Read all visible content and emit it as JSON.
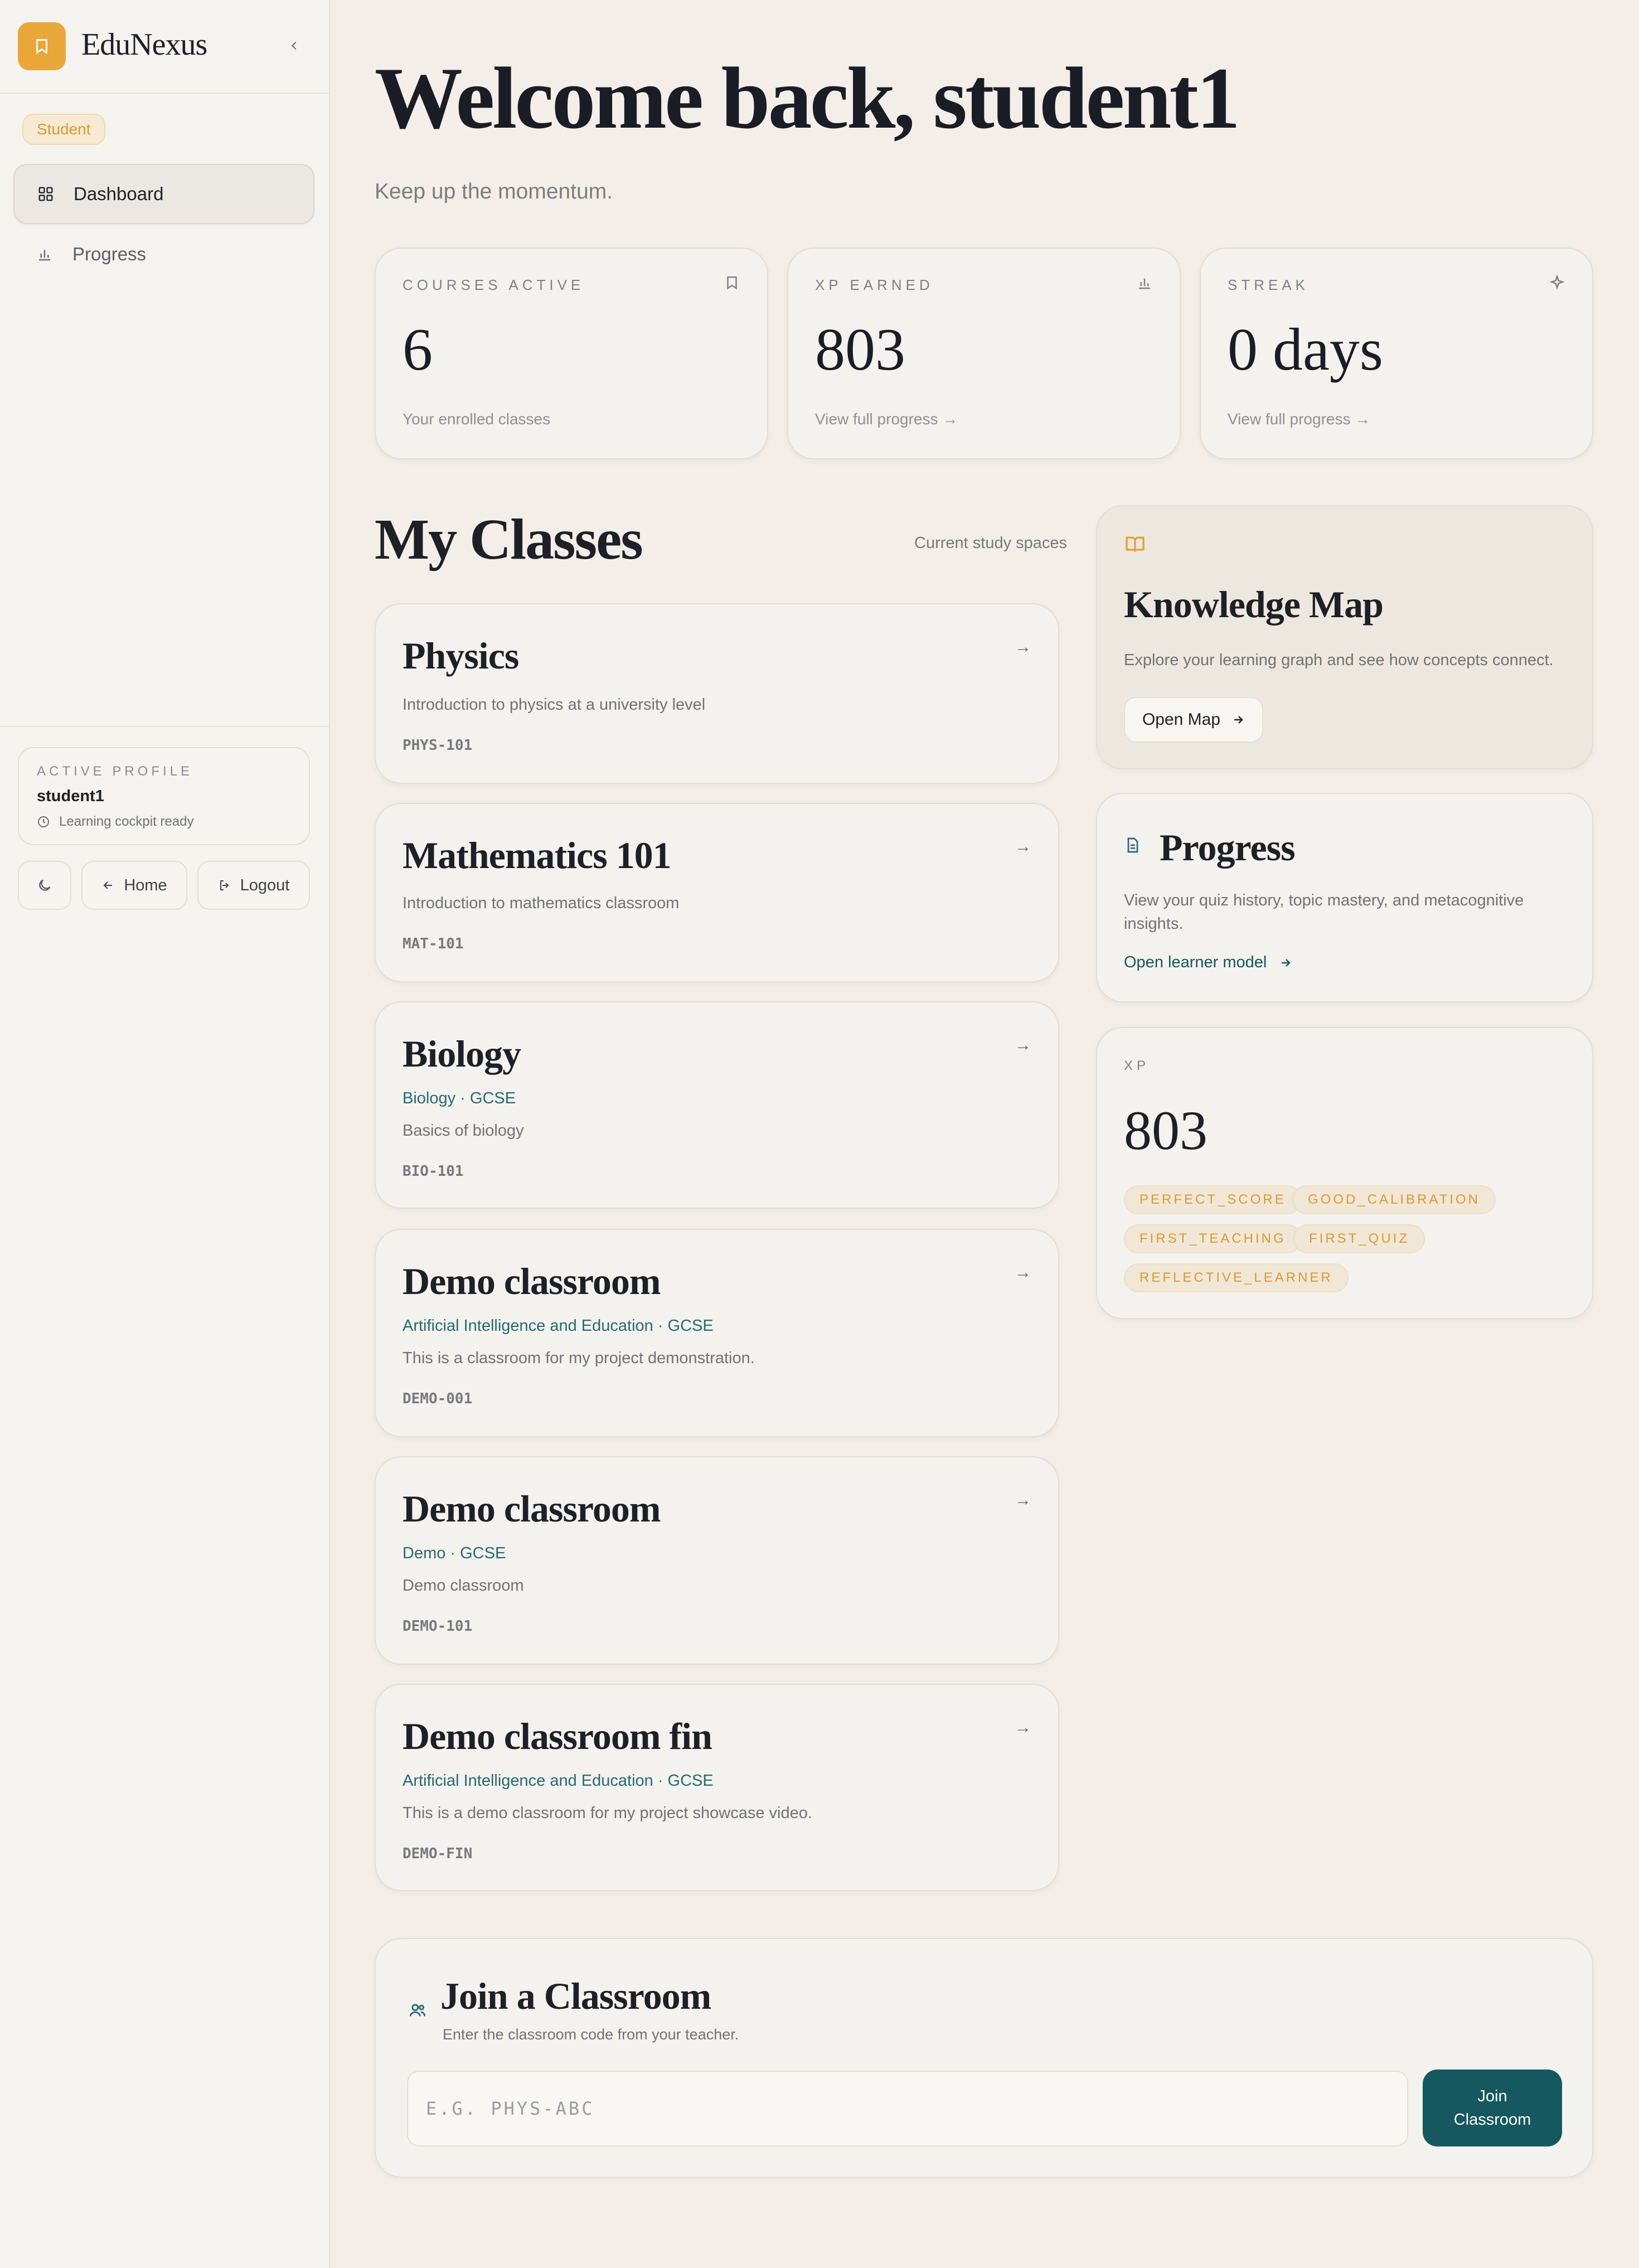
{
  "app": {
    "name": "EduNexus"
  },
  "sidebar": {
    "role": "Student",
    "nav": [
      {
        "label": "Dashboard",
        "icon": "grid-icon",
        "active": true
      },
      {
        "label": "Progress",
        "icon": "bar-chart-icon",
        "active": false
      }
    ],
    "profile": {
      "caption": "ACTIVE PROFILE",
      "name": "student1",
      "status": "Learning cockpit ready"
    },
    "buttons": {
      "home": "Home",
      "logout": "Logout"
    }
  },
  "header": {
    "title": "Welcome back, student1",
    "subtitle": "Keep up the momentum."
  },
  "stats": [
    {
      "caption": "COURSES ACTIVE",
      "value": "6",
      "sub": "Your enrolled classes",
      "icon": "book-icon"
    },
    {
      "caption": "XP EARNED",
      "value": "803",
      "sub": "View full progress →",
      "icon": "bar-chart-icon"
    },
    {
      "caption": "STREAK",
      "value": "0 days",
      "sub": "View full progress →",
      "icon": "sparkle-icon"
    }
  ],
  "classes_section": {
    "title": "My Classes",
    "aside": "Current study spaces"
  },
  "classes": [
    {
      "title": "Physics",
      "tags": "",
      "description": "Introduction to physics at a university level",
      "code": "PHYS-101"
    },
    {
      "title": "Mathematics 101",
      "tags": "",
      "description": "Introduction to mathematics classroom",
      "code": "MAT-101"
    },
    {
      "title": "Biology",
      "tags": "Biology · GCSE",
      "description": "Basics of biology",
      "code": "BIO-101"
    },
    {
      "title": "Demo classroom",
      "tags": "Artificial Intelligence and Education · GCSE",
      "description": "This is a classroom for my project demonstration.",
      "code": "DEMO-001"
    },
    {
      "title": "Demo classroom",
      "tags": "Demo · GCSE",
      "description": "Demo classroom",
      "code": "DEMO-101"
    },
    {
      "title": "Demo classroom fin",
      "tags": "Artificial Intelligence and Education · GCSE",
      "description": "This is a demo classroom for my project showcase video.",
      "code": "DEMO-FIN"
    }
  ],
  "knowledge_map": {
    "title": "Knowledge Map",
    "description": "Explore your learning graph and see how concepts connect.",
    "button": "Open Map"
  },
  "progress_card": {
    "title": "Progress",
    "description": "View your quiz history, topic mastery, and metacognitive insights.",
    "link": "Open learner model"
  },
  "xp_card": {
    "caption": "XP",
    "value": "803",
    "achievements": [
      "PERFECT_SCORE",
      "GOOD_CALIBRATION",
      "FIRST_TEACHING",
      "FIRST_QUIZ",
      "REFLECTIVE_LEARNER"
    ]
  },
  "join": {
    "title": "Join a Classroom",
    "subtitle": "Enter the classroom code from your teacher.",
    "placeholder": "E.G. PHYS-ABC",
    "button": "Join Classroom"
  },
  "colors": {
    "accent": "#e9a73a",
    "teal": "#16585f",
    "background": "#f3efe8"
  }
}
